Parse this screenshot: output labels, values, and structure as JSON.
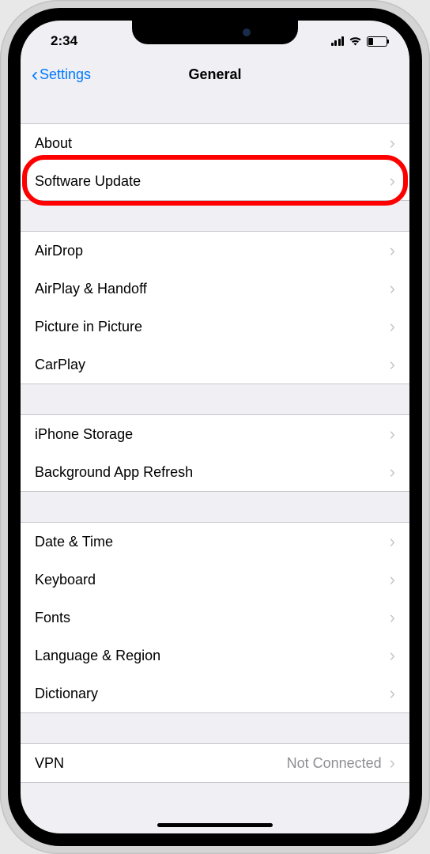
{
  "statusBar": {
    "time": "2:34"
  },
  "nav": {
    "back": "Settings",
    "title": "General"
  },
  "groups": [
    {
      "items": [
        {
          "label": "About",
          "id": "about"
        },
        {
          "label": "Software Update",
          "id": "software-update",
          "highlighted": true
        }
      ]
    },
    {
      "items": [
        {
          "label": "AirDrop",
          "id": "airdrop"
        },
        {
          "label": "AirPlay & Handoff",
          "id": "airplay-handoff"
        },
        {
          "label": "Picture in Picture",
          "id": "picture-in-picture"
        },
        {
          "label": "CarPlay",
          "id": "carplay"
        }
      ]
    },
    {
      "items": [
        {
          "label": "iPhone Storage",
          "id": "iphone-storage"
        },
        {
          "label": "Background App Refresh",
          "id": "background-app-refresh"
        }
      ]
    },
    {
      "items": [
        {
          "label": "Date & Time",
          "id": "date-time"
        },
        {
          "label": "Keyboard",
          "id": "keyboard"
        },
        {
          "label": "Fonts",
          "id": "fonts"
        },
        {
          "label": "Language & Region",
          "id": "language-region"
        },
        {
          "label": "Dictionary",
          "id": "dictionary"
        }
      ]
    },
    {
      "items": [
        {
          "label": "VPN",
          "id": "vpn",
          "value": "Not Connected"
        }
      ]
    }
  ]
}
